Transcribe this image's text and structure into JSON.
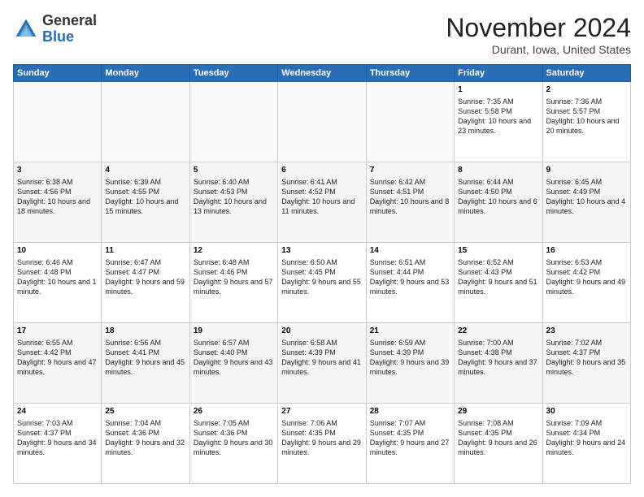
{
  "logo": {
    "general": "General",
    "blue": "Blue"
  },
  "header": {
    "month": "November 2024",
    "location": "Durant, Iowa, United States"
  },
  "weekdays": [
    "Sunday",
    "Monday",
    "Tuesday",
    "Wednesday",
    "Thursday",
    "Friday",
    "Saturday"
  ],
  "weeks": [
    [
      {
        "day": "",
        "info": ""
      },
      {
        "day": "",
        "info": ""
      },
      {
        "day": "",
        "info": ""
      },
      {
        "day": "",
        "info": ""
      },
      {
        "day": "",
        "info": ""
      },
      {
        "day": "1",
        "info": "Sunrise: 7:35 AM\nSunset: 5:58 PM\nDaylight: 10 hours and 23 minutes."
      },
      {
        "day": "2",
        "info": "Sunrise: 7:36 AM\nSunset: 5:57 PM\nDaylight: 10 hours and 20 minutes."
      }
    ],
    [
      {
        "day": "3",
        "info": "Sunrise: 6:38 AM\nSunset: 4:56 PM\nDaylight: 10 hours and 18 minutes."
      },
      {
        "day": "4",
        "info": "Sunrise: 6:39 AM\nSunset: 4:55 PM\nDaylight: 10 hours and 15 minutes."
      },
      {
        "day": "5",
        "info": "Sunrise: 6:40 AM\nSunset: 4:53 PM\nDaylight: 10 hours and 13 minutes."
      },
      {
        "day": "6",
        "info": "Sunrise: 6:41 AM\nSunset: 4:52 PM\nDaylight: 10 hours and 11 minutes."
      },
      {
        "day": "7",
        "info": "Sunrise: 6:42 AM\nSunset: 4:51 PM\nDaylight: 10 hours and 8 minutes."
      },
      {
        "day": "8",
        "info": "Sunrise: 6:44 AM\nSunset: 4:50 PM\nDaylight: 10 hours and 6 minutes."
      },
      {
        "day": "9",
        "info": "Sunrise: 6:45 AM\nSunset: 4:49 PM\nDaylight: 10 hours and 4 minutes."
      }
    ],
    [
      {
        "day": "10",
        "info": "Sunrise: 6:46 AM\nSunset: 4:48 PM\nDaylight: 10 hours and 1 minute."
      },
      {
        "day": "11",
        "info": "Sunrise: 6:47 AM\nSunset: 4:47 PM\nDaylight: 9 hours and 59 minutes."
      },
      {
        "day": "12",
        "info": "Sunrise: 6:48 AM\nSunset: 4:46 PM\nDaylight: 9 hours and 57 minutes."
      },
      {
        "day": "13",
        "info": "Sunrise: 6:50 AM\nSunset: 4:45 PM\nDaylight: 9 hours and 55 minutes."
      },
      {
        "day": "14",
        "info": "Sunrise: 6:51 AM\nSunset: 4:44 PM\nDaylight: 9 hours and 53 minutes."
      },
      {
        "day": "15",
        "info": "Sunrise: 6:52 AM\nSunset: 4:43 PM\nDaylight: 9 hours and 51 minutes."
      },
      {
        "day": "16",
        "info": "Sunrise: 6:53 AM\nSunset: 4:42 PM\nDaylight: 9 hours and 49 minutes."
      }
    ],
    [
      {
        "day": "17",
        "info": "Sunrise: 6:55 AM\nSunset: 4:42 PM\nDaylight: 9 hours and 47 minutes."
      },
      {
        "day": "18",
        "info": "Sunrise: 6:56 AM\nSunset: 4:41 PM\nDaylight: 9 hours and 45 minutes."
      },
      {
        "day": "19",
        "info": "Sunrise: 6:57 AM\nSunset: 4:40 PM\nDaylight: 9 hours and 43 minutes."
      },
      {
        "day": "20",
        "info": "Sunrise: 6:58 AM\nSunset: 4:39 PM\nDaylight: 9 hours and 41 minutes."
      },
      {
        "day": "21",
        "info": "Sunrise: 6:59 AM\nSunset: 4:39 PM\nDaylight: 9 hours and 39 minutes."
      },
      {
        "day": "22",
        "info": "Sunrise: 7:00 AM\nSunset: 4:38 PM\nDaylight: 9 hours and 37 minutes."
      },
      {
        "day": "23",
        "info": "Sunrise: 7:02 AM\nSunset: 4:37 PM\nDaylight: 9 hours and 35 minutes."
      }
    ],
    [
      {
        "day": "24",
        "info": "Sunrise: 7:03 AM\nSunset: 4:37 PM\nDaylight: 9 hours and 34 minutes."
      },
      {
        "day": "25",
        "info": "Sunrise: 7:04 AM\nSunset: 4:36 PM\nDaylight: 9 hours and 32 minutes."
      },
      {
        "day": "26",
        "info": "Sunrise: 7:05 AM\nSunset: 4:36 PM\nDaylight: 9 hours and 30 minutes."
      },
      {
        "day": "27",
        "info": "Sunrise: 7:06 AM\nSunset: 4:35 PM\nDaylight: 9 hours and 29 minutes."
      },
      {
        "day": "28",
        "info": "Sunrise: 7:07 AM\nSunset: 4:35 PM\nDaylight: 9 hours and 27 minutes."
      },
      {
        "day": "29",
        "info": "Sunrise: 7:08 AM\nSunset: 4:35 PM\nDaylight: 9 hours and 26 minutes."
      },
      {
        "day": "30",
        "info": "Sunrise: 7:09 AM\nSunset: 4:34 PM\nDaylight: 9 hours and 24 minutes."
      }
    ]
  ]
}
